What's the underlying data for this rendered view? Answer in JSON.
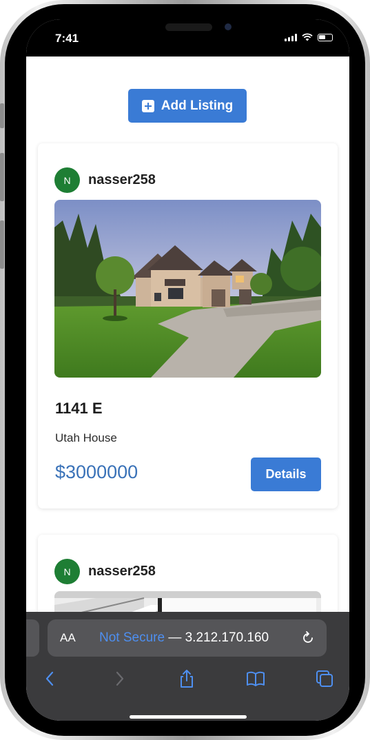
{
  "status_bar": {
    "time": "7:41"
  },
  "header": {
    "add_listing_label": "Add Listing"
  },
  "listings": [
    {
      "owner": {
        "initial": "N",
        "username": "nasser258"
      },
      "title": "1141 E",
      "description": "Utah House",
      "price": "$3000000",
      "details_label": "Details"
    },
    {
      "owner": {
        "initial": "N",
        "username": "nasser258"
      }
    }
  ],
  "browser": {
    "aa_label": "AA",
    "security_label": "Not Secure",
    "separator": " — ",
    "host": "3.212.170.160"
  },
  "colors": {
    "accent": "#3a7bd5",
    "price": "#3a72b8",
    "avatar": "#1e7e34",
    "safari_bar": "#3b3b3d",
    "safari_link": "#4e8ff0"
  },
  "icons": [
    "plus-square-icon",
    "reload-icon",
    "back-icon",
    "forward-icon",
    "share-icon",
    "bookmarks-icon",
    "tabs-icon"
  ]
}
